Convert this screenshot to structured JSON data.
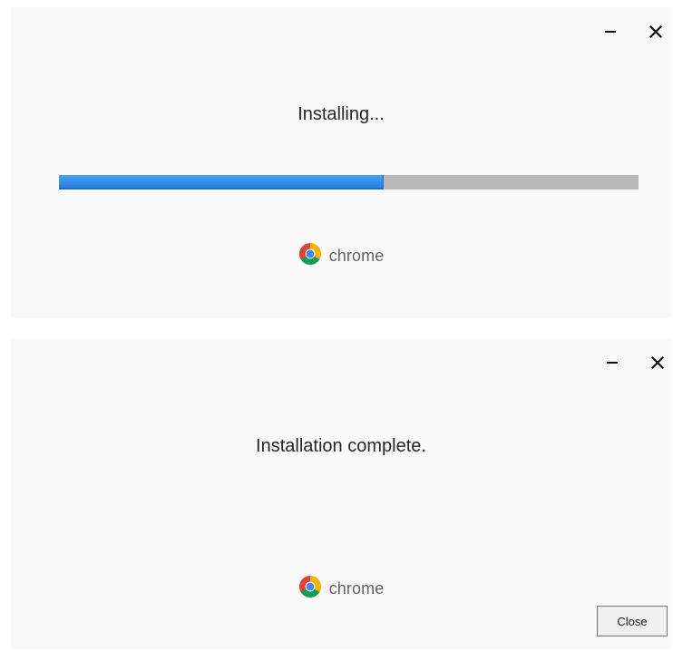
{
  "installing_window": {
    "status_text": "Installing...",
    "progress_percent": 56,
    "brand_name": "chrome",
    "controls": {
      "minimize_icon": "minimize-icon",
      "close_icon": "close-icon"
    },
    "colors": {
      "progress_fill": "#2d8ae8",
      "progress_track": "#b9b9b9",
      "background": "#f9f9f9"
    }
  },
  "complete_window": {
    "status_text": "Installation complete.",
    "brand_name": "chrome",
    "close_button_label": "Close",
    "controls": {
      "minimize_icon": "minimize-icon",
      "close_icon": "close-icon"
    },
    "colors": {
      "background": "#f9f9f9"
    }
  }
}
